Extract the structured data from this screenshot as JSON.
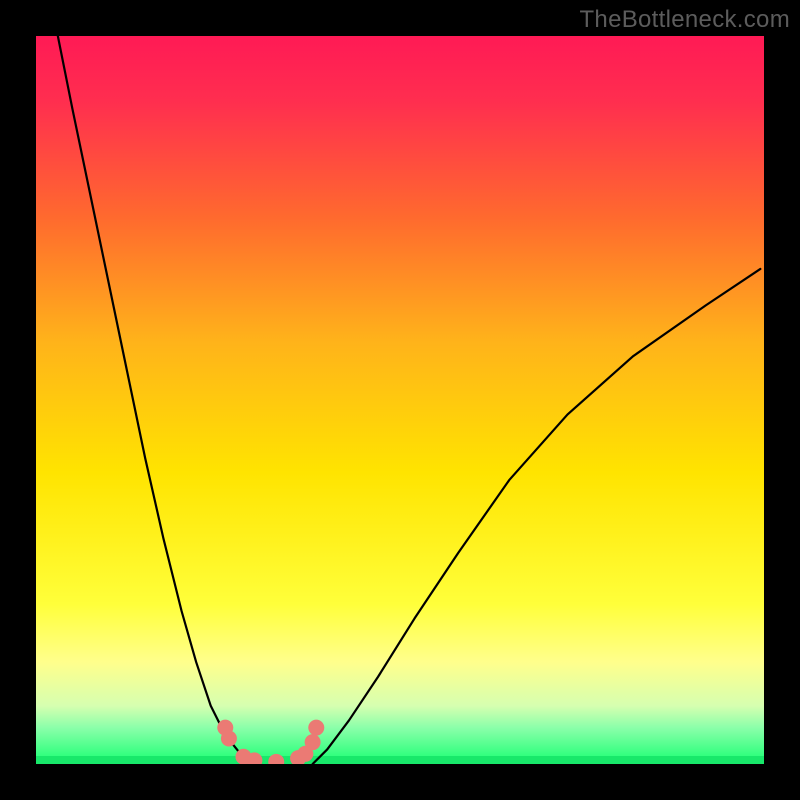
{
  "watermark": "TheBottleneck.com",
  "chart_data": {
    "type": "line",
    "title": "",
    "xlabel": "",
    "ylabel": "",
    "xlim": [
      0,
      1
    ],
    "ylim": [
      0,
      100
    ],
    "background_gradient_top": "#ff1a55",
    "background_gradient_mid": "#ffe400",
    "background_gradient_band": "#ffff8c",
    "background_gradient_bottom": "#18ff72",
    "series": [
      {
        "name": "curve-left",
        "color": "#000000",
        "x": [
          0.03,
          0.05,
          0.075,
          0.1,
          0.125,
          0.15,
          0.175,
          0.2,
          0.22,
          0.24,
          0.26,
          0.28,
          0.3
        ],
        "y": [
          100,
          90,
          78,
          66,
          54,
          42,
          31,
          21,
          14,
          8,
          4,
          1.5,
          0
        ]
      },
      {
        "name": "curve-right",
        "color": "#000000",
        "x": [
          0.38,
          0.4,
          0.43,
          0.47,
          0.52,
          0.58,
          0.65,
          0.73,
          0.82,
          0.92,
          0.995
        ],
        "y": [
          0,
          2,
          6,
          12,
          20,
          29,
          39,
          48,
          56,
          63,
          68
        ]
      }
    ],
    "points": {
      "name": "dip-points",
      "color": "#eb7a74",
      "radius": 8,
      "xy": [
        [
          0.26,
          5.0
        ],
        [
          0.265,
          3.5
        ],
        [
          0.285,
          1.0
        ],
        [
          0.3,
          0.5
        ],
        [
          0.33,
          0.3
        ],
        [
          0.36,
          0.8
        ],
        [
          0.37,
          1.4
        ],
        [
          0.38,
          3.0
        ],
        [
          0.385,
          5.0
        ]
      ]
    }
  }
}
